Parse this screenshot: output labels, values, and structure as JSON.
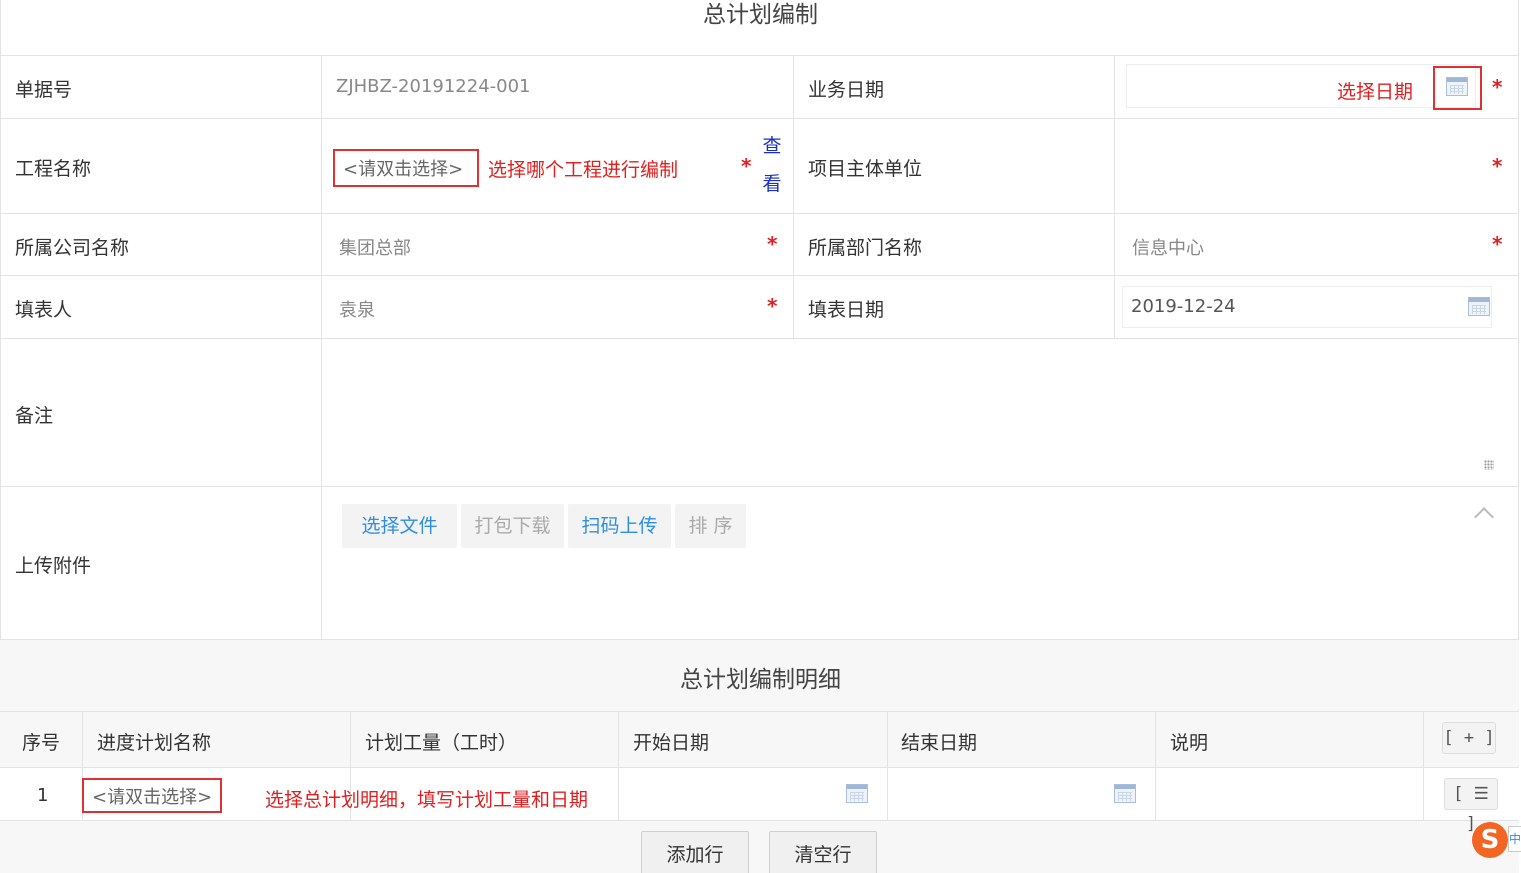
{
  "page_title": "总计划编制",
  "form": {
    "doc_no_label": "单据号",
    "doc_no_value": "ZJHBZ-20191224-001",
    "biz_date_label": "业务日期",
    "biz_date_note": "选择日期",
    "project_name_label": "工程名称",
    "project_name_placeholder": "<请双击选择>",
    "project_name_note": "选择哪个工程进行编制",
    "view_link": "查看",
    "view_link_1": "查",
    "view_link_2": "看",
    "owner_unit_label": "项目主体单位",
    "company_label": "所属公司名称",
    "company_value": "集团总部",
    "dept_label": "所属部门名称",
    "dept_value": "信息中心",
    "filler_label": "填表人",
    "filler_value": "袁泉",
    "fill_date_label": "填表日期",
    "fill_date_value": "2019-12-24",
    "remark_label": "备注",
    "attach_label": "上传附件",
    "required_mark": "*"
  },
  "attach_buttons": {
    "choose_file": "选择文件",
    "pack_download": "打包下载",
    "scan_upload": "扫码上传",
    "sort": "排 序"
  },
  "detail": {
    "title": "总计划编制明细",
    "columns": [
      "序号",
      "进度计划名称",
      "计划工量（工时）",
      "开始日期",
      "结束日期",
      "说明"
    ],
    "add_icon": "[ + ]",
    "menu_icon": "[ ☰ ]",
    "row_index": "1",
    "row_placeholder": "<请双击选择>",
    "row_note": "选择总计划明细，填写计划工量和日期",
    "add_row": "添加行",
    "clear_rows": "清空行"
  },
  "ime": {
    "logo": "S",
    "tab": "中"
  },
  "colors": {
    "accent_red": "#e02020",
    "link_blue": "#1a2fc4",
    "button_blue": "#2e8fe0",
    "ime_orange": "#f26522"
  }
}
